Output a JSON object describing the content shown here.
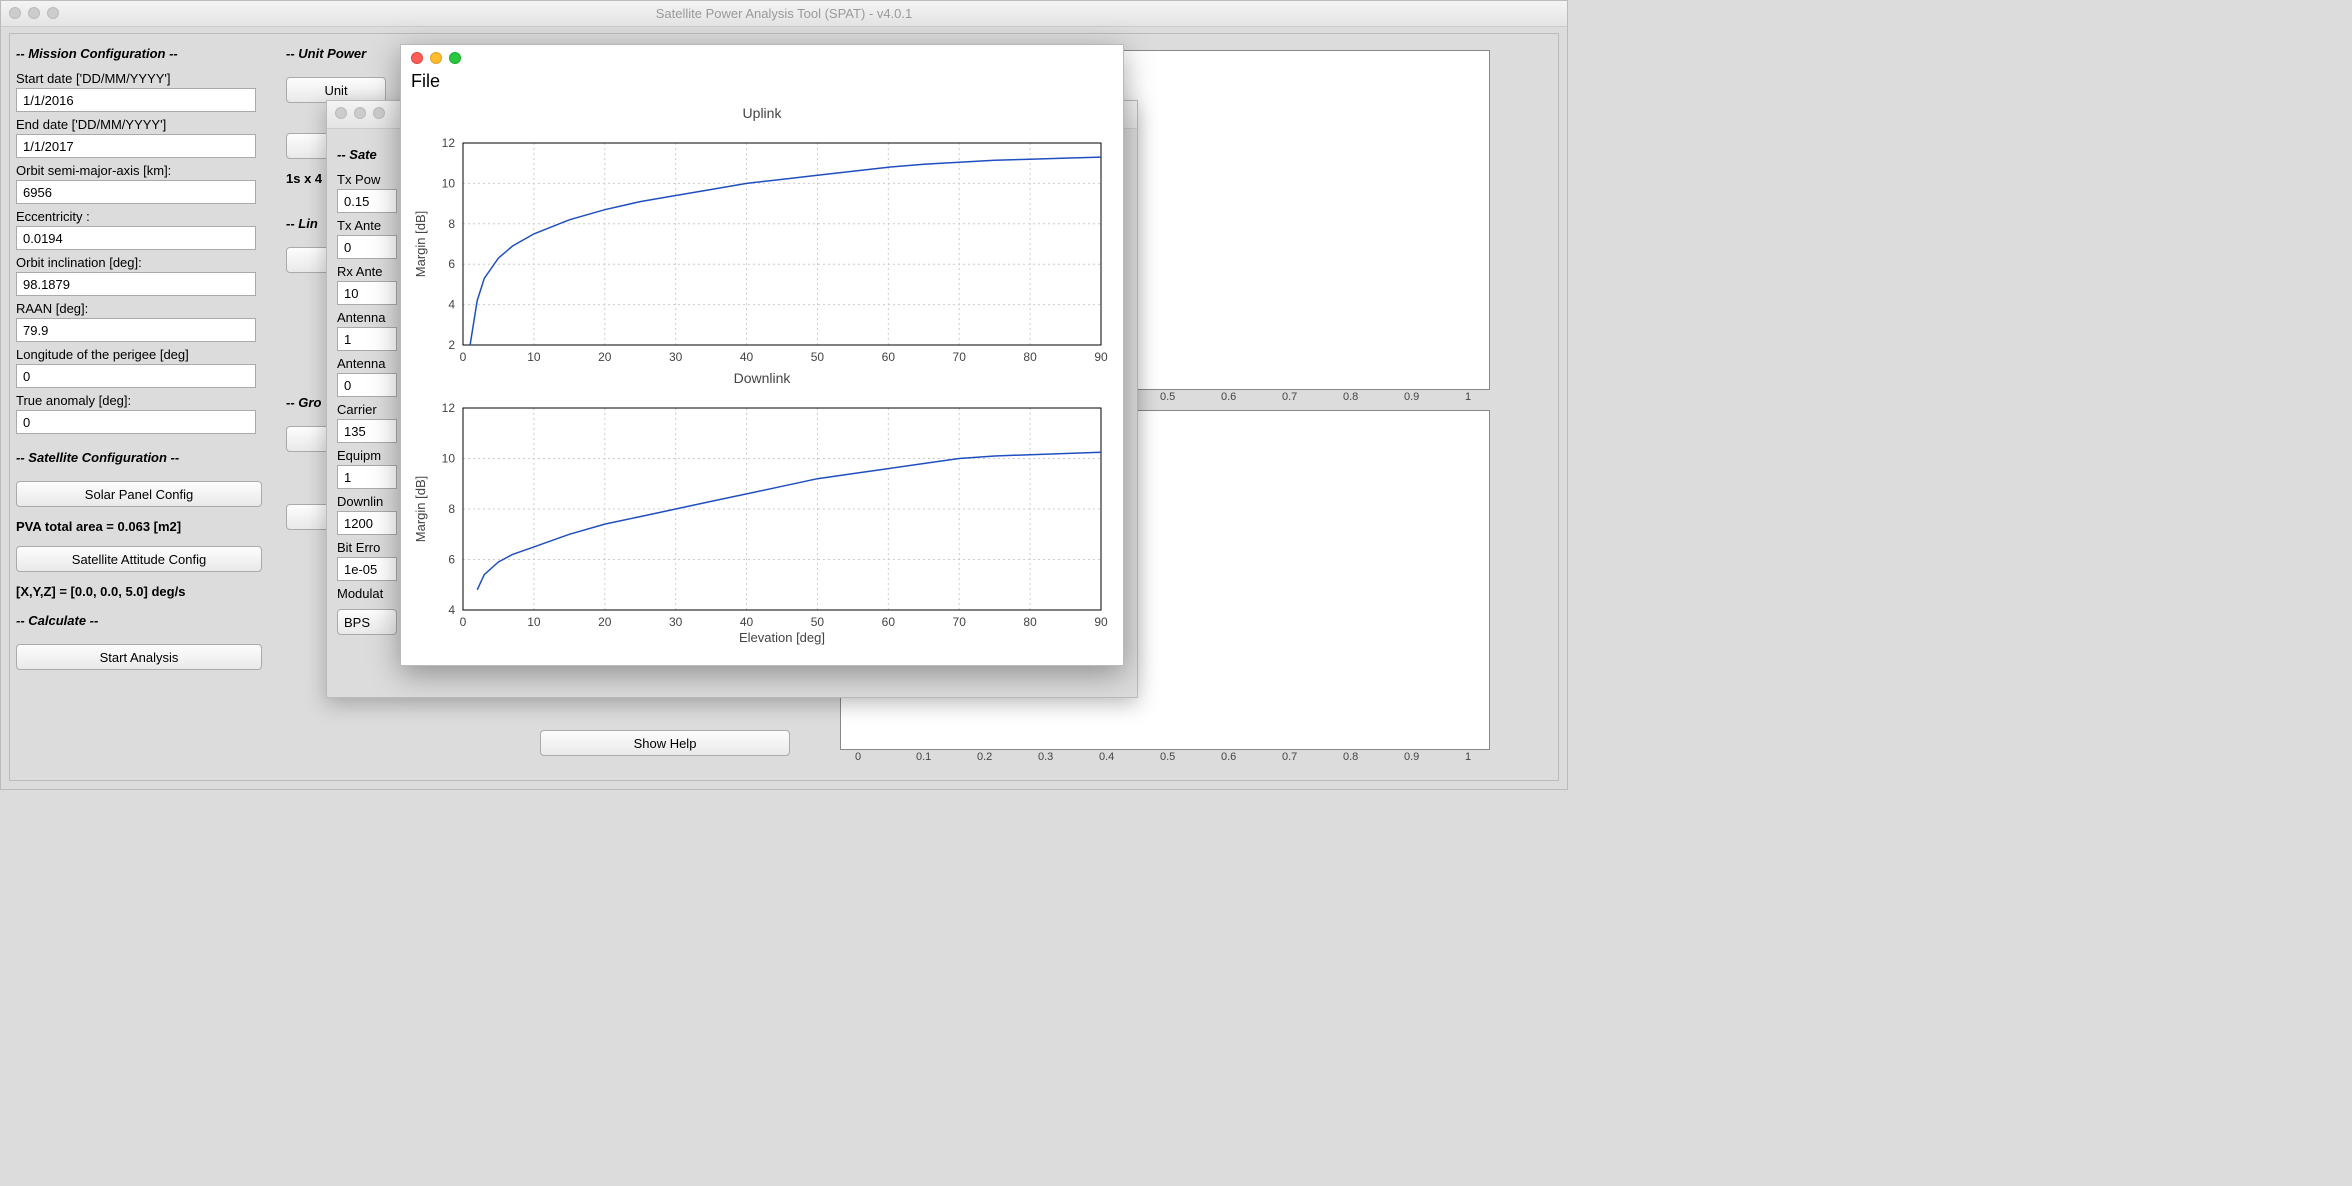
{
  "app_title": "Satellite Power Analysis Tool (SPAT) - v4.0.1",
  "mission": {
    "section": "-- Mission Configuration --",
    "start_label": "Start date ['DD/MM/YYYY']",
    "start_value": "1/1/2016",
    "end_label": "End date ['DD/MM/YYYY']",
    "end_value": "1/1/2017",
    "sma_label": "Orbit semi-major-axis [km]:",
    "sma_value": "6956",
    "ecc_label": "Eccentricity :",
    "ecc_value": "0.0194",
    "inc_label": "Orbit inclination [deg]:",
    "inc_value": "98.1879",
    "raan_label": "RAAN [deg]:",
    "raan_value": "79.9",
    "perigee_label": "Longitude of the perigee [deg]",
    "perigee_value": "0",
    "anom_label": "True anomaly [deg]:",
    "anom_value": "0"
  },
  "satcfg": {
    "section": "-- Satellite Configuration --",
    "solar_btn": "Solar Panel Config",
    "pva_text": "PVA total area = 0.063 [m2]",
    "attitude_btn": "Satellite Attitude Config",
    "xyz_text": "[X,Y,Z] = [0.0, 0.0, 5.0] deg/s",
    "calc_section": "-- Calculate --",
    "start_btn": "Start Analysis"
  },
  "unit_power": {
    "section": "-- Unit Power ",
    "btn": "Unit",
    "row_text": "1s x 4"
  },
  "link_col": {
    "lin_section": "-- Lin",
    "gro_section": "-- Gro"
  },
  "sub": {
    "section": "-- Sate",
    "txpow_label": "Tx Pow",
    "txpow_value": "0.15",
    "txant_label": "Tx Ante",
    "txant_value": "0",
    "rxant_label": "Rx Ante",
    "rxant_value": "10",
    "ant1_label": "Antenna",
    "ant1_value": "1",
    "ant2_label": "Antenna",
    "ant2_value": "0",
    "carrier_label": "Carrier",
    "carrier_value": "135",
    "equip_label": "Equipm",
    "equip_value": "1",
    "down_label": "Downlin",
    "down_value": "1200",
    "ber_label": "Bit Erro",
    "ber_value": "1e-05",
    "mod_label": "Modulat",
    "mod_value": "BPS"
  },
  "show_help": "Show Help",
  "chart_menu": "File",
  "chart_data": [
    {
      "type": "line",
      "title": "Uplink",
      "xlabel": "",
      "ylabel": "Margin [dB]",
      "xlim": [
        0,
        90
      ],
      "ylim": [
        2,
        12
      ],
      "xticks": [
        0,
        10,
        20,
        30,
        40,
        50,
        60,
        70,
        80,
        90
      ],
      "yticks": [
        2,
        4,
        6,
        8,
        10,
        12
      ],
      "x": [
        1,
        2,
        3,
        5,
        7,
        10,
        15,
        20,
        25,
        30,
        35,
        40,
        45,
        50,
        55,
        60,
        65,
        70,
        75,
        80,
        85,
        90
      ],
      "y": [
        2.0,
        4.2,
        5.3,
        6.3,
        6.9,
        7.5,
        8.2,
        8.7,
        9.1,
        9.4,
        9.7,
        10.0,
        10.2,
        10.4,
        10.6,
        10.8,
        10.95,
        11.05,
        11.15,
        11.2,
        11.25,
        11.3
      ]
    },
    {
      "type": "line",
      "title": "Downlink",
      "xlabel": "Elevation [deg]",
      "ylabel": "Margin [dB]",
      "xlim": [
        0,
        90
      ],
      "ylim": [
        4,
        12
      ],
      "xticks": [
        0,
        10,
        20,
        30,
        40,
        50,
        60,
        70,
        80,
        90
      ],
      "yticks": [
        4,
        6,
        8,
        10,
        12
      ],
      "x": [
        2,
        3,
        5,
        7,
        10,
        15,
        20,
        25,
        30,
        35,
        40,
        45,
        50,
        55,
        60,
        65,
        70,
        75,
        80,
        85,
        90
      ],
      "y": [
        4.8,
        5.4,
        5.9,
        6.2,
        6.5,
        7.0,
        7.4,
        7.7,
        8.0,
        8.3,
        8.6,
        8.9,
        9.2,
        9.4,
        9.6,
        9.8,
        10.0,
        10.1,
        10.15,
        10.2,
        10.25
      ]
    }
  ],
  "right_plot_xticks": [
    "0",
    "0.1",
    "0.2",
    "0.3",
    "0.4",
    "0.5",
    "0.6",
    "0.7",
    "0.8",
    "0.9",
    "1"
  ]
}
